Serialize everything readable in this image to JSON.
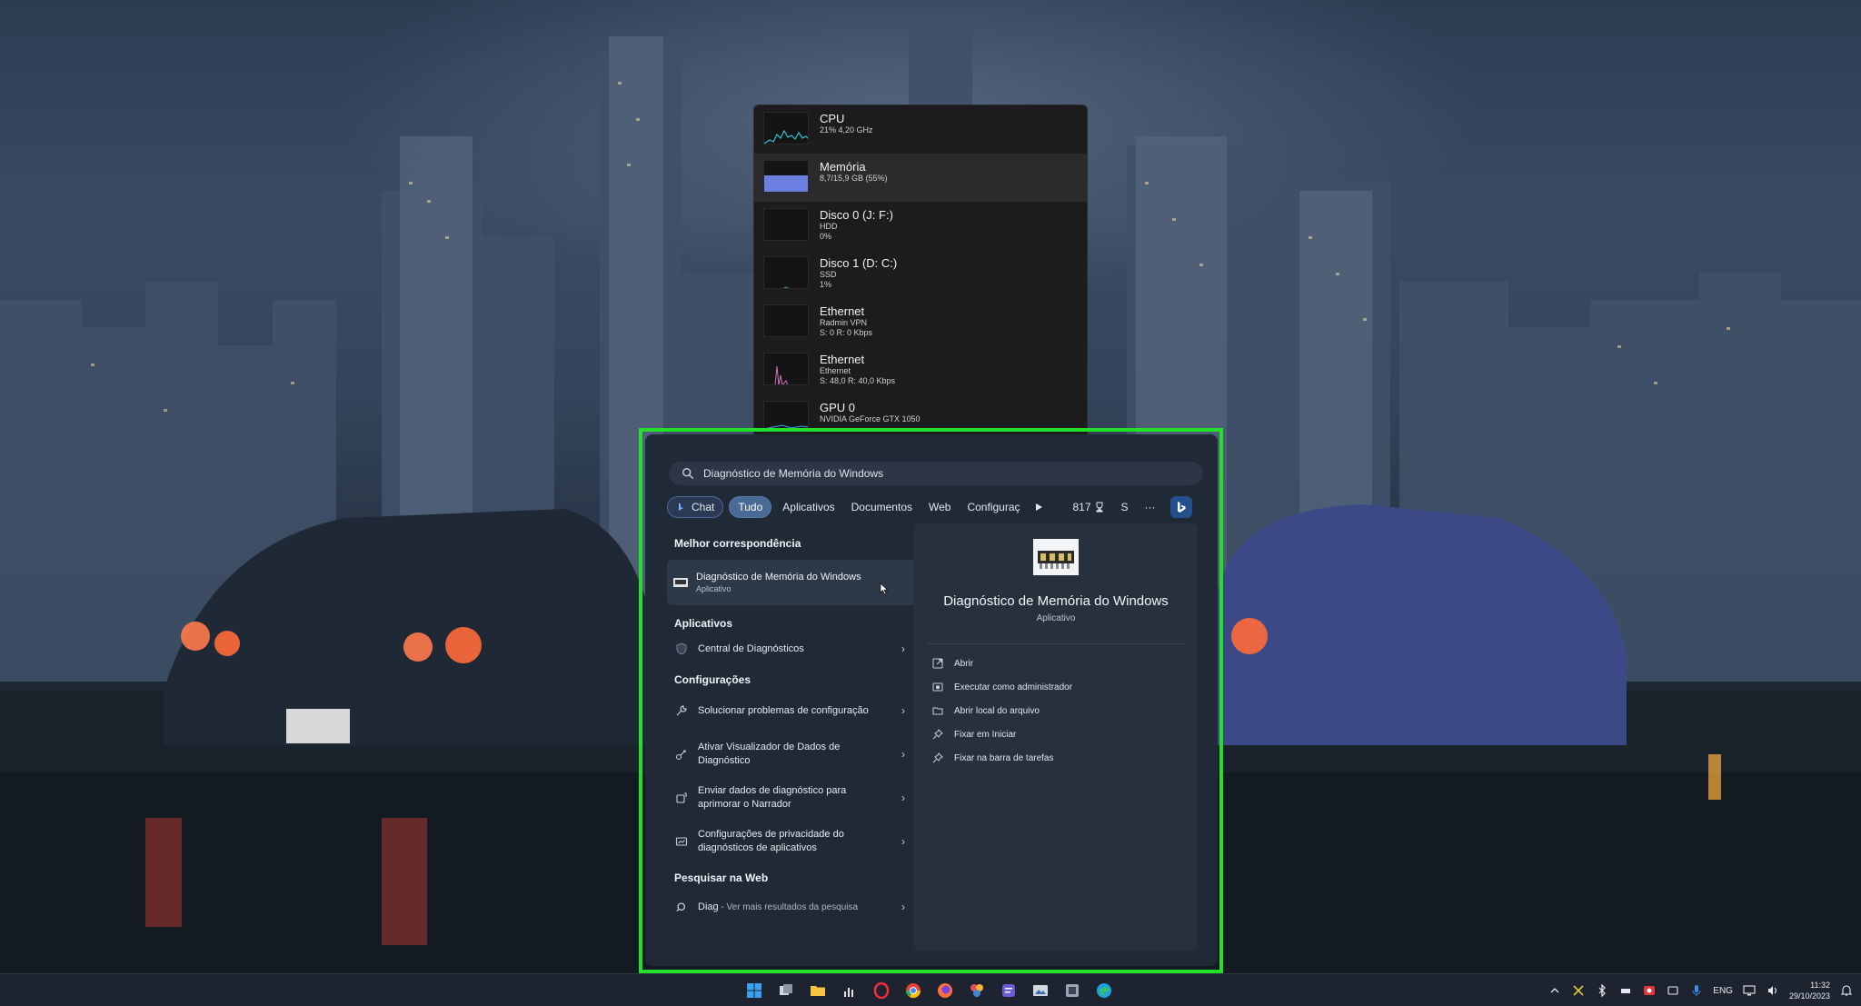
{
  "task_manager": {
    "rows": [
      {
        "name": "CPU",
        "lines": [
          "21% 4,20 GHz"
        ],
        "graph": "cpu-graph"
      },
      {
        "name": "Memória",
        "lines": [
          "8,7/15,9 GB (55%)"
        ],
        "graph": "memory-graph"
      },
      {
        "name": "Disco 0 (J: F:)",
        "lines": [
          "HDD",
          "0%"
        ],
        "graph": "disk-graph"
      },
      {
        "name": "Disco 1 (D: C:)",
        "lines": [
          "SSD",
          "1%"
        ],
        "graph": "disk-graph"
      },
      {
        "name": "Ethernet",
        "lines": [
          "Radmin VPN",
          "S: 0 R: 0 Kbps"
        ],
        "graph": "ethernet-graph"
      },
      {
        "name": "Ethernet",
        "lines": [
          "Ethernet",
          "S: 48,0 R: 40,0 Kbps"
        ],
        "graph": "ethernet-graph"
      },
      {
        "name": "GPU 0",
        "lines": [
          "NVIDIA GeForce GTX 1050"
        ],
        "graph": "gpu-graph"
      }
    ]
  },
  "search": {
    "query": "Diagnóstico de Memória do Windows",
    "filters": {
      "chat": "Chat",
      "all": "Tudo",
      "apps": "Aplicativos",
      "documents": "Documentos",
      "web": "Web",
      "settings": "Configuraç",
      "points": "817",
      "user_initial": "S",
      "more": "···"
    }
  },
  "results": {
    "best_match_title": "Melhor correspondência",
    "best_match": {
      "name": "Diagnóstico de Memória do Windows",
      "type": "Aplicativo"
    },
    "apps_title": "Aplicativos",
    "apps": [
      {
        "label": "Central de Diagnósticos"
      }
    ],
    "settings_title": "Configurações",
    "settings": [
      {
        "label": "Solucionar problemas de configuração"
      },
      {
        "label": "Ativar Visualizador de Dados de Diagnóstico"
      },
      {
        "label": "Enviar dados de diagnóstico para aprimorar o Narrador"
      },
      {
        "label": "Configurações de privacidade do diagnósticos de aplicativos"
      }
    ],
    "web_title": "Pesquisar na Web",
    "web": {
      "query": "Diag",
      "suffix": " - Ver mais resultados da pesquisa"
    }
  },
  "preview": {
    "title": "Diagnóstico de Memória do Windows",
    "type": "Aplicativo",
    "actions": [
      {
        "label": "Abrir",
        "icon": "open-icon"
      },
      {
        "label": "Executar como administrador",
        "icon": "shield-admin-icon"
      },
      {
        "label": "Abrir local do arquivo",
        "icon": "folder-icon"
      },
      {
        "label": "Fixar em Iniciar",
        "icon": "pin-icon"
      },
      {
        "label": "Fixar na barra de tarefas",
        "icon": "pin-icon"
      }
    ]
  },
  "taskbar": {
    "apps": [
      "windows-start-icon",
      "task-view-icon",
      "file-explorer-icon",
      "performance-icon",
      "opera-icon",
      "chrome-icon",
      "firefox-icon",
      "photos-icon",
      "notes-icon",
      "media-icon",
      "network-tool-icon",
      "edge-icon"
    ],
    "language": "ENG",
    "time": "11:32",
    "date": "29/10/2023"
  },
  "colors": {
    "highlight": "#22e02a",
    "accent": "#4a6a96"
  }
}
